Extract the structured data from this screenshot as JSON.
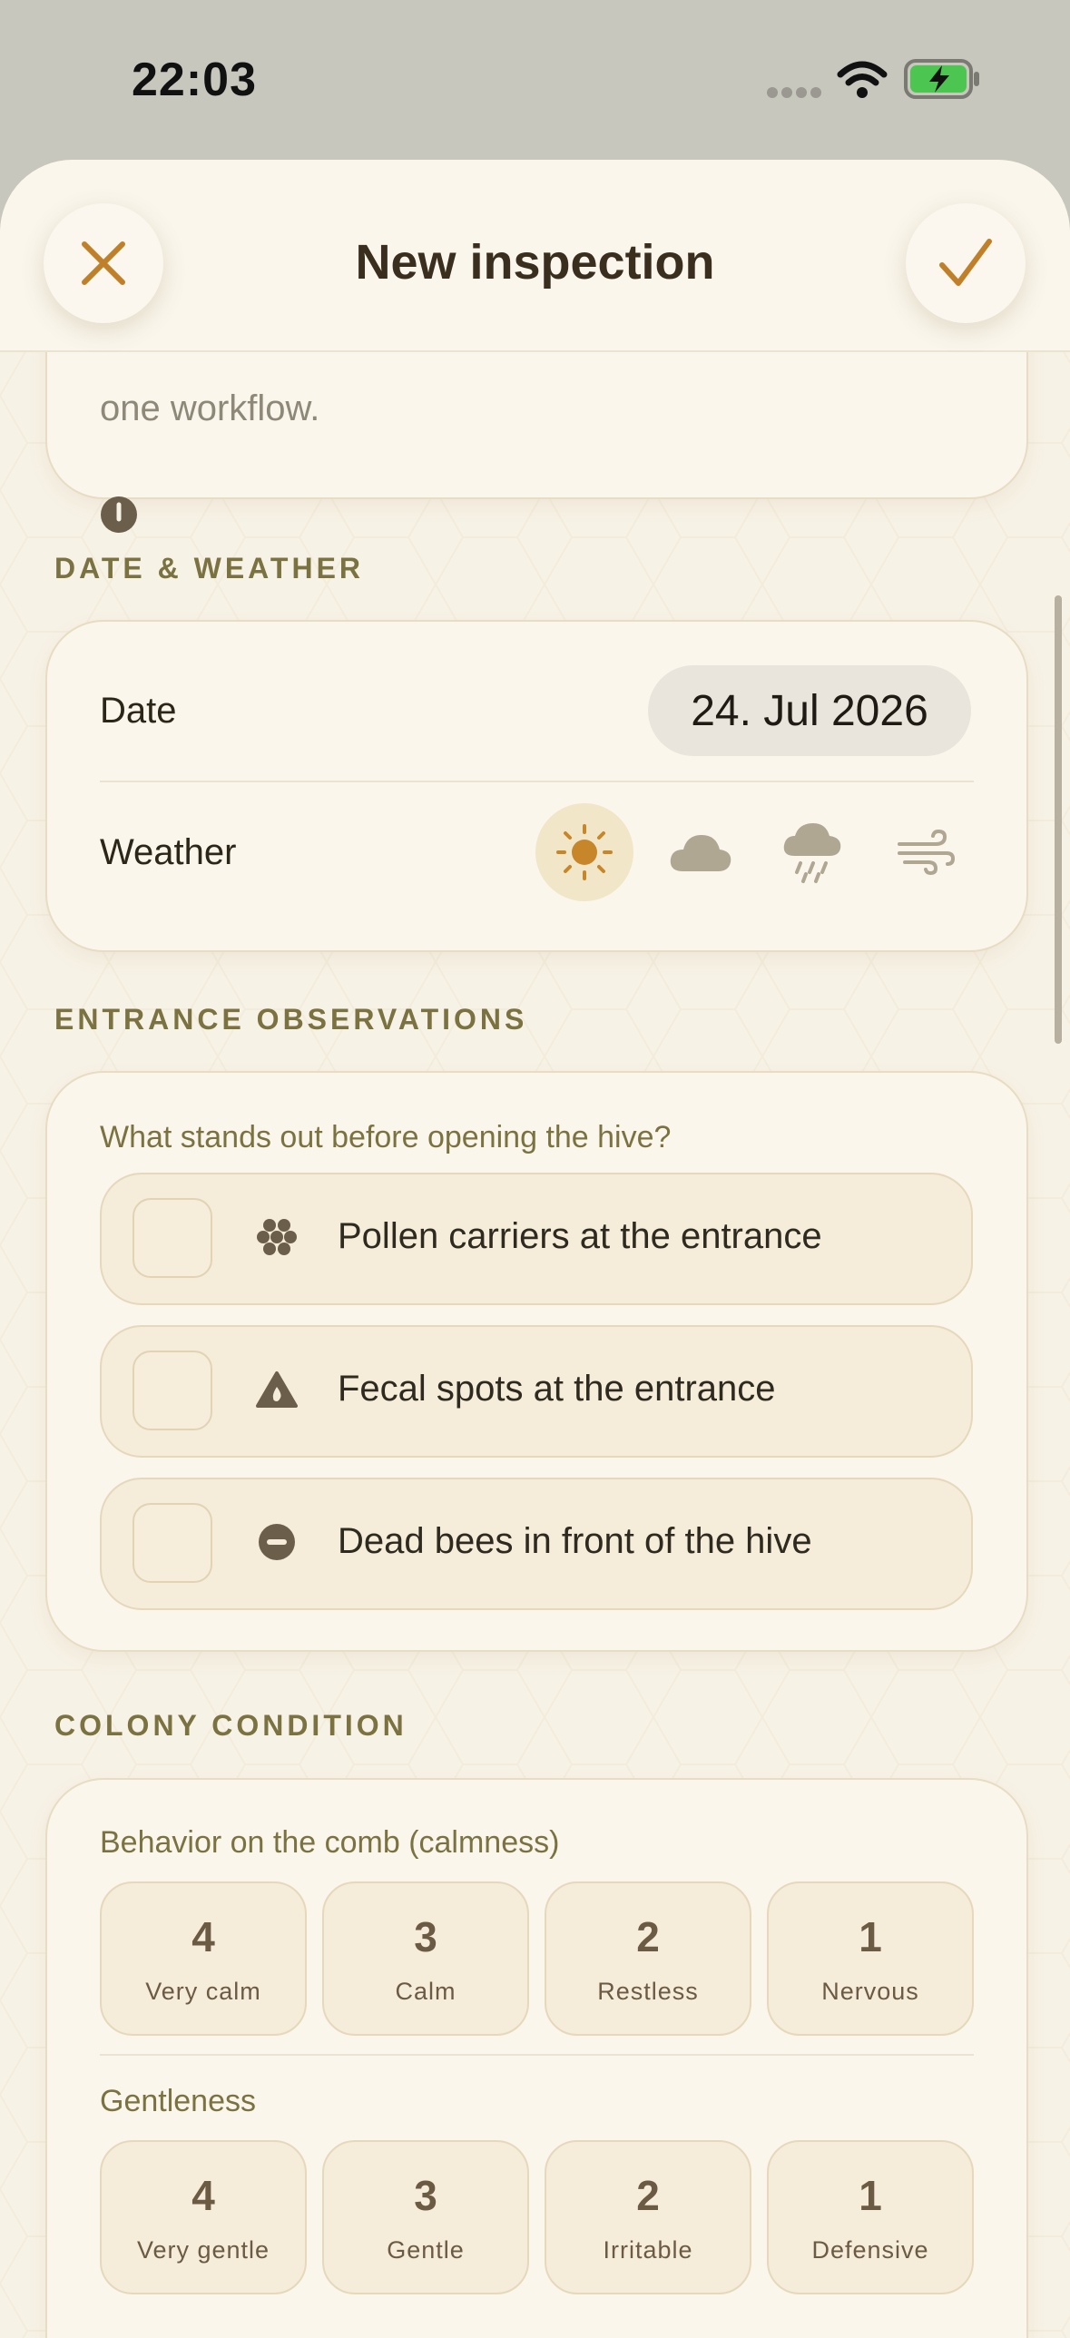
{
  "status_bar": {
    "time": "22:03"
  },
  "nav": {
    "title": "New inspection",
    "close_icon": "close-icon",
    "confirm_icon": "checkmark-icon"
  },
  "top_card": {
    "text_fragment": "one workflow."
  },
  "date_weather": {
    "section_title": "DATE & WEATHER",
    "date_label": "Date",
    "date_value": "24. Jul 2026",
    "weather_label": "Weather",
    "weather_options": [
      {
        "icon": "sun-icon",
        "selected": true
      },
      {
        "icon": "cloud-icon",
        "selected": false
      },
      {
        "icon": "rain-cloud-icon",
        "selected": false
      },
      {
        "icon": "wind-icon",
        "selected": false
      }
    ]
  },
  "entrance": {
    "section_title": "ENTRANCE OBSERVATIONS",
    "prompt": "What stands out before opening the hive?",
    "items": [
      {
        "label": "Pollen carriers at the entrance",
        "icon": "pollen-icon",
        "checked": false
      },
      {
        "label": "Fecal spots at the entrance",
        "icon": "drop-triangle-icon",
        "checked": false
      },
      {
        "label": "Dead bees in front of the hive",
        "icon": "minus-circle-icon",
        "checked": false
      }
    ]
  },
  "colony": {
    "section_title": "COLONY CONDITION",
    "calmness": {
      "label": "Behavior on the comb (calmness)",
      "options": [
        {
          "num": "4",
          "label": "Very calm"
        },
        {
          "num": "3",
          "label": "Calm"
        },
        {
          "num": "2",
          "label": "Restless"
        },
        {
          "num": "1",
          "label": "Nervous"
        }
      ]
    },
    "gentleness": {
      "label": "Gentleness",
      "options": [
        {
          "num": "4",
          "label": "Very gentle"
        },
        {
          "num": "3",
          "label": "Gentle"
        },
        {
          "num": "2",
          "label": "Irritable"
        },
        {
          "num": "1",
          "label": "Defensive"
        }
      ]
    }
  },
  "colors": {
    "accent": "#c0802a",
    "section": "#7b7242",
    "background": "#f7f2e6"
  }
}
